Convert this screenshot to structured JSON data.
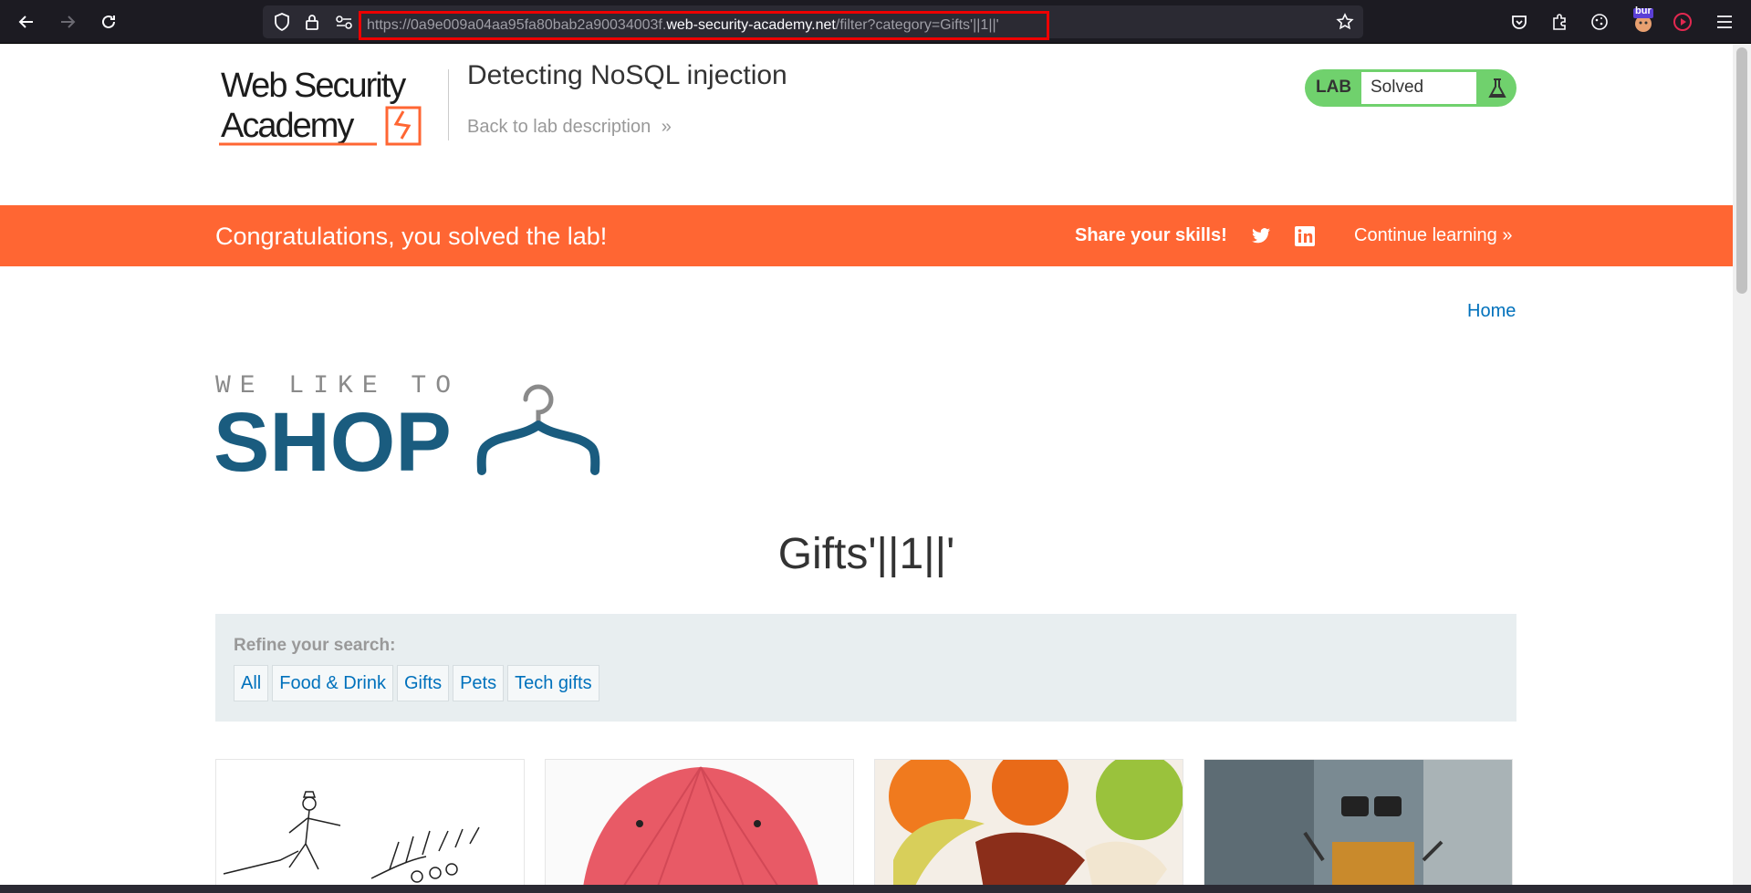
{
  "browser": {
    "url_prefix": "https://0a9e009a04aa95fa80bab2a90034003f.",
    "url_host": "web-security-academy.net",
    "url_path": "/filter?category=Gifts'||1||'",
    "extension_badge": "bur"
  },
  "header": {
    "logo_text": [
      "Web Security",
      "Academy"
    ],
    "lab_title": "Detecting NoSQL injection",
    "back_link": "Back to lab description",
    "lab_tag": "LAB",
    "lab_status": "Solved"
  },
  "banner": {
    "congrats": "Congratulations, you solved the lab!",
    "share": "Share your skills!",
    "continue": "Continue learning"
  },
  "nav": {
    "home": "Home"
  },
  "shop_logo": {
    "tagline": "WE LIKE TO",
    "word": "SHOP"
  },
  "main": {
    "heading": "Gifts'||1||'",
    "refine_label": "Refine your search:",
    "filters": [
      "All",
      "Food & Drink",
      "Gifts",
      "Pets",
      "Tech gifts"
    ]
  },
  "colors": {
    "banner": "#ff6633",
    "lab_green": "#70d16d",
    "link_blue": "#0071bc",
    "shop_blue": "#1a5c7f"
  }
}
